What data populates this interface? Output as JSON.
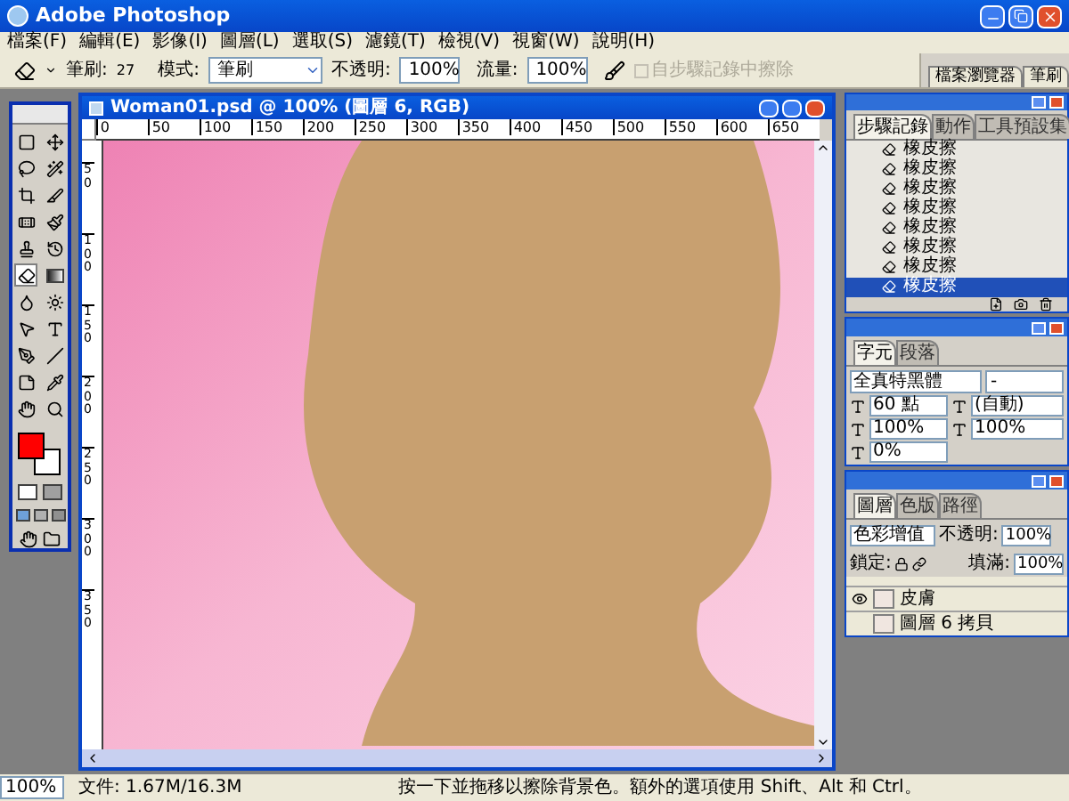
{
  "window": {
    "title": "Adobe Photoshop"
  },
  "menu": [
    "檔案(F)",
    "編輯(E)",
    "影像(I)",
    "圖層(L)",
    "選取(S)",
    "濾鏡(T)",
    "檢視(V)",
    "視窗(W)",
    "說明(H)"
  ],
  "options_bar": {
    "brush_label": "筆刷:",
    "brush_size": "27",
    "mode_label": "模式:",
    "mode": "筆刷",
    "opacity_label": "不透明:",
    "opacity": "100%",
    "flow_label": "流量:",
    "flow": "100%",
    "erase_to_history": {
      "label": "自步驟記錄中擦除",
      "checked": false,
      "disabled": true
    }
  },
  "panel_well": [
    {
      "label": "檔案瀏覽器"
    },
    {
      "label": "筆刷"
    }
  ],
  "toolbox": {
    "tools": [
      {
        "kind": "marquee",
        "selected": false
      },
      {
        "kind": "move",
        "selected": false
      },
      {
        "kind": "lasso",
        "selected": false
      },
      {
        "kind": "wand",
        "selected": false
      },
      {
        "kind": "crop",
        "selected": false
      },
      {
        "kind": "slice",
        "selected": false
      },
      {
        "kind": "healing",
        "selected": false
      },
      {
        "kind": "brush",
        "selected": false
      },
      {
        "kind": "stamp",
        "selected": false
      },
      {
        "kind": "history_brush",
        "selected": false
      },
      {
        "kind": "eraser",
        "selected": true
      },
      {
        "kind": "gradient",
        "selected": false
      },
      {
        "kind": "blur",
        "selected": false
      },
      {
        "kind": "dodge",
        "selected": false
      },
      {
        "kind": "select",
        "selected": false
      },
      {
        "kind": "type",
        "selected": false
      },
      {
        "kind": "pen",
        "selected": false
      },
      {
        "kind": "line",
        "selected": false
      },
      {
        "kind": "notes",
        "selected": false
      },
      {
        "kind": "eyedropper",
        "selected": false
      },
      {
        "kind": "hand",
        "selected": false
      },
      {
        "kind": "zoom",
        "selected": false
      }
    ],
    "swatches": [
      {
        "kind": "foreground",
        "color": "#ff0000"
      },
      {
        "kind": "background",
        "color": "#ffffff"
      }
    ]
  },
  "document": {
    "title": "Woman01.psd @ 100% (圖層 6, RGB)",
    "ruler_h": [
      "0",
      "50",
      "100",
      "150",
      "200",
      "250",
      "300",
      "350",
      "400",
      "450",
      "500",
      "550",
      "600",
      "650"
    ],
    "ruler_v": [
      "50",
      "100",
      "150",
      "200",
      "250",
      "300",
      "350"
    ]
  },
  "history": {
    "tabs": [
      {
        "label": "步驟記錄",
        "selected": true
      },
      {
        "label": "動作",
        "selected": false
      },
      {
        "label": "工具預設集",
        "selected": false
      }
    ],
    "items": [
      {
        "label": "橡皮擦",
        "selected": false
      },
      {
        "label": "橡皮擦",
        "selected": false
      },
      {
        "label": "橡皮擦",
        "selected": false
      },
      {
        "label": "橡皮擦",
        "selected": false
      },
      {
        "label": "橡皮擦",
        "selected": false
      },
      {
        "label": "橡皮擦",
        "selected": false
      },
      {
        "label": "橡皮擦",
        "selected": false
      },
      {
        "label": "橡皮擦",
        "selected": true
      }
    ]
  },
  "character": {
    "tabs": [
      {
        "label": "字元",
        "selected": true
      },
      {
        "label": "段落",
        "selected": false
      }
    ],
    "font": "全真特黑體",
    "style": "-",
    "size": "60 點",
    "leading": "(自動)",
    "vertical_scale": "100%",
    "horizontal_scale": "100%",
    "baseline": "0%"
  },
  "layers": {
    "tabs": [
      {
        "label": "圖層",
        "selected": true
      },
      {
        "label": "色版",
        "selected": false
      },
      {
        "label": "路徑",
        "selected": false
      }
    ],
    "blend_mode": "色彩增值",
    "opacity_label": "不透明:",
    "opacity": "100%",
    "lock_label": "鎖定:",
    "fill_label": "填滿:",
    "fill": "100%",
    "items": [
      {
        "name": "皮膚",
        "visible": true
      },
      {
        "name": "圖層 6 拷貝",
        "visible": false
      }
    ]
  },
  "status_bar": {
    "zoom": "100%",
    "doc_size": "文件: 1.67M/16.3M",
    "hint": "按一下並拖移以擦除背景色。額外的選項使用 Shift、Alt 和 Ctrl。"
  }
}
